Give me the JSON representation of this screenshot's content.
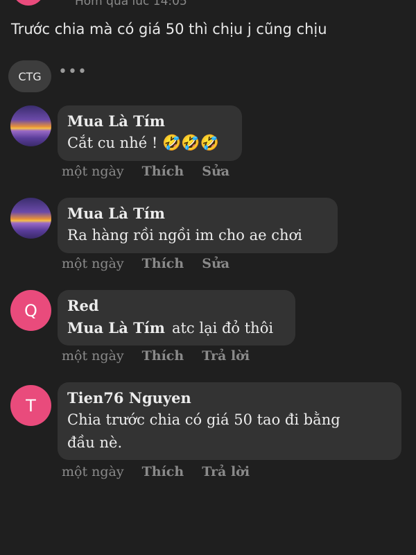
{
  "header": {
    "time": "Hôm qua lúc 14:05",
    "post_text": "Trước chia mà có giá 50 thì chịu j cũng chịu"
  },
  "ctg": {
    "label": "CTG",
    "more": "•••"
  },
  "comments": [
    {
      "author": "Mua Là Tím",
      "text": "Cắt cu nhé ! ",
      "emoji": "🤣🤣🤣",
      "time": "một ngày",
      "like": "Thích",
      "action": "Sửa"
    },
    {
      "author": "Mua Là Tím",
      "text": "Ra hàng rồi ngồi im cho ae chơi",
      "time": "một ngày",
      "like": "Thích",
      "action": "Sửa"
    },
    {
      "author": "Red",
      "avatar_letter": "Q",
      "mention": "Mua Là Tím",
      "text": "atc lại đỏ thôi",
      "time": "một ngày",
      "like": "Thích",
      "action": "Trả lời"
    },
    {
      "author": "Tien76 Nguyen",
      "avatar_letter": "T",
      "text_line1": "Chia trước chia có giá 50 tao đi bằng",
      "text_line2": "đầu nè.",
      "time": "một ngày",
      "like": "Thích",
      "action": "Trả lời"
    }
  ],
  "colors": {
    "background": "#1f1f1f",
    "bubble": "#333333",
    "avatar_pink": "#e94b7c",
    "muted_text": "#8a8a8a"
  }
}
